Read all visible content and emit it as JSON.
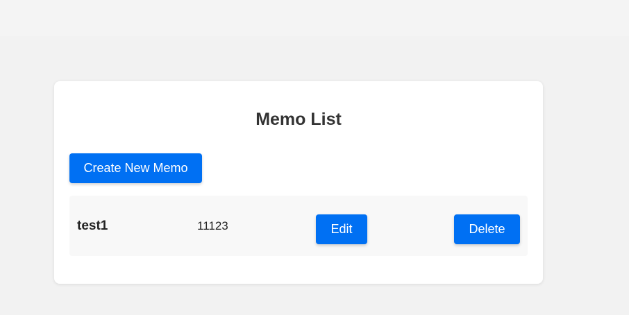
{
  "page": {
    "title": "Memo List",
    "create_button_label": "Create New Memo"
  },
  "memos": [
    {
      "title": "test1",
      "content": "11123",
      "edit_label": "Edit",
      "delete_label": "Delete"
    }
  ],
  "colors": {
    "accent": "#0070f3",
    "background": "#f2f2f2",
    "card": "#ffffff",
    "row": "#f8f8f8",
    "text": "#333333"
  }
}
